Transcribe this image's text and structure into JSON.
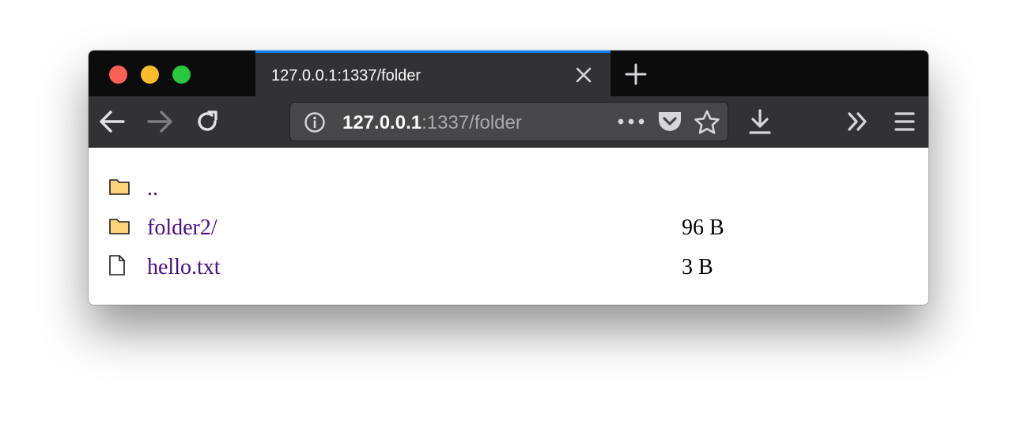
{
  "tab": {
    "title": "127.0.0.1:1337/folder"
  },
  "urlbar": {
    "host": "127.0.0.1",
    "path": ":1337/folder"
  },
  "colors": {
    "accent": "#0a84ff",
    "link": "#4b0f82",
    "folder": "#ffd27e",
    "toolbar": "#323234"
  },
  "listing": [
    {
      "icon": "folder-icon",
      "name": "..",
      "size": ""
    },
    {
      "icon": "folder-icon",
      "name": "folder2/",
      "size": "96 B"
    },
    {
      "icon": "file-icon",
      "name": "hello.txt",
      "size": "3 B"
    }
  ]
}
